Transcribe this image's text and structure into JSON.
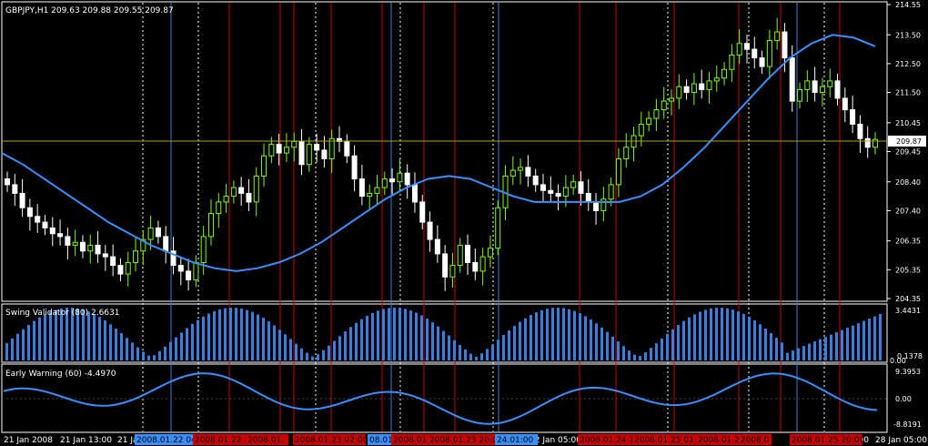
{
  "main_title": "GBPJPY,H1  209.63 209.88 209.55 209.87",
  "price_label": "209.87",
  "price_scale": [
    "214.55",
    "213.50",
    "212.50",
    "211.50",
    "210.45",
    "209.45",
    "208.40",
    "207.40",
    "206.35",
    "205.35",
    "204.35"
  ],
  "sub1_title": "Swing Validator (80) 2.6631",
  "sub1_scale": [
    "3.4431",
    "0.1378",
    "0.00"
  ],
  "sub2_title": "Early Warning (60) -4.4970",
  "sub2_scale": [
    "9.3953",
    "0.00",
    "-8.8191"
  ],
  "time_labels": [
    "21 Jan 2008",
    "21 Jan 13:00",
    "21 Ja",
    "22 Jan 05:00",
    "28 Jan 05:00",
    "21:00"
  ],
  "time_tags": [
    {
      "text": "2008.01.22 04:",
      "color": "blue"
    },
    {
      "text": "2008.01.22 12:00",
      "color": "red"
    },
    {
      "text": "2008.01.",
      "color": "red"
    },
    {
      "text": "2008.01.23 02:00",
      "color": "red"
    },
    {
      "text": "08.01.",
      "color": "blue"
    },
    {
      "text": "2008.01.",
      "color": "red"
    },
    {
      "text": "2008.01.23 20:00",
      "color": "red"
    },
    {
      "text": "24.01:00",
      "color": "blue"
    },
    {
      "text": "2008.01.24 17:",
      "color": "red"
    },
    {
      "text": "2008.01.25 01:0",
      "color": "red"
    },
    {
      "text": "2008.01.25",
      "color": "red"
    },
    {
      "text": "2008.0",
      "color": "red"
    },
    {
      "text": "2008.01.25 20:00",
      "color": "red"
    }
  ],
  "colors": {
    "bull": "#7CFC00",
    "bear": "#ffffff",
    "ma": "#3a8fff",
    "hist": "#3a7fe0",
    "ew": "#3a8fff",
    "red_line": "#cc0000",
    "blue_line": "#3a7fd0",
    "tag_red": "#cc0000",
    "tag_blue": "#3a8fff"
  },
  "chart_data": {
    "type": "candlestick",
    "price_ylim": [
      204.35,
      214.55
    ],
    "candles_close_sketch": [
      208.3,
      208.0,
      207.5,
      207.2,
      207.0,
      206.8,
      206.6,
      206.5,
      206.2,
      206.3,
      206.0,
      206.2,
      205.9,
      205.8,
      205.5,
      205.2,
      205.6,
      206.0,
      206.4,
      206.8,
      206.5,
      206.0,
      205.5,
      205.3,
      205.0,
      205.6,
      206.5,
      207.3,
      207.7,
      207.9,
      208.2,
      208.0,
      207.7,
      208.6,
      209.3,
      209.7,
      209.4,
      209.6,
      209.8,
      209.0,
      209.7,
      209.5,
      209.2,
      209.9,
      209.8,
      209.3,
      208.5,
      207.9,
      208.0,
      208.2,
      208.5,
      208.4,
      208.7,
      208.3,
      207.7,
      207.0,
      206.4,
      205.9,
      205.1,
      205.5,
      206.2,
      205.6,
      205.3,
      205.8,
      206.1,
      207.5,
      208.6,
      208.8,
      208.9,
      208.6,
      208.3,
      208.1,
      208.0,
      207.9,
      208.2,
      208.4,
      208.0,
      207.7,
      207.4,
      207.8,
      208.3,
      209.2,
      209.6,
      210.0,
      210.4,
      210.6,
      210.9,
      211.2,
      211.3,
      211.7,
      211.5,
      211.8,
      211.6,
      211.9,
      212.0,
      212.3,
      212.8,
      213.2,
      213.0,
      212.7,
      212.4,
      213.3,
      213.6,
      212.7,
      211.2,
      211.6,
      211.9,
      211.5,
      211.7,
      211.9,
      211.3,
      210.9,
      210.4,
      209.9,
      209.6,
      209.87
    ],
    "ma_sketch": [
      209.4,
      209.0,
      208.5,
      208.0,
      207.5,
      207.0,
      206.6,
      206.2,
      205.9,
      205.6,
      205.4,
      205.3,
      205.4,
      205.6,
      205.9,
      206.3,
      206.8,
      207.3,
      207.8,
      208.2,
      208.5,
      208.6,
      208.5,
      208.2,
      207.9,
      207.7,
      207.7,
      207.7,
      207.7,
      207.7,
      207.9,
      208.3,
      208.9,
      209.6,
      210.4,
      211.2,
      212.0,
      212.7,
      213.2,
      213.5,
      213.4,
      213.1
    ]
  }
}
